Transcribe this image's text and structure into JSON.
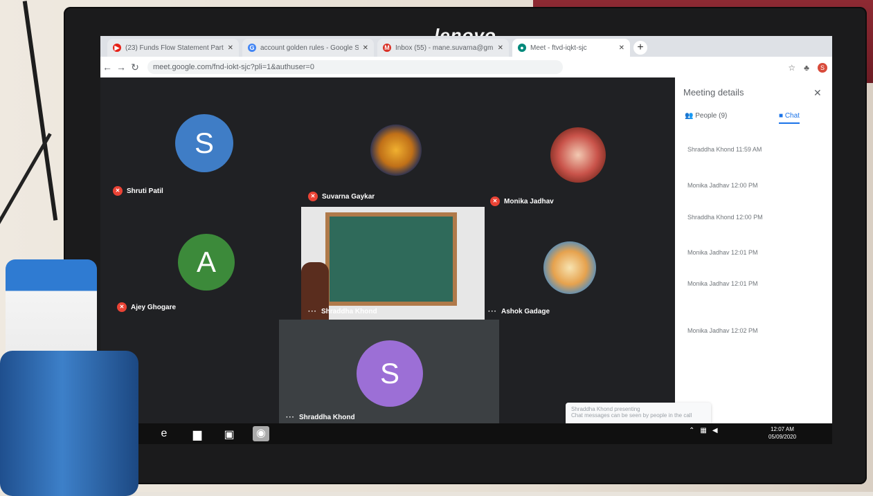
{
  "monitor": {
    "brand": "lenovo"
  },
  "browser": {
    "tabs": [
      {
        "icon": "youtube-icon",
        "icon_color": "#e62117",
        "title": "(23) Funds Flow Statement Part"
      },
      {
        "icon": "google-icon",
        "icon_color": "#4285f4",
        "title": "account golden rules - Google S"
      },
      {
        "icon": "gmail-icon",
        "icon_color": "#d93025",
        "title": "Inbox (55) - mane.suvarna@gm"
      },
      {
        "icon": "meet-icon",
        "icon_color": "#00897b",
        "title": "Meet - ftvd-iqkt-sjc"
      }
    ],
    "new_tab": "+",
    "url": "meet.google.com/fnd-iokt-sjc?pli=1&authuser=0"
  },
  "meet": {
    "participants": [
      {
        "name": "Shruti Patil",
        "initial": "S",
        "color": "#3f7dc6",
        "muted": true
      },
      {
        "name": "Suvarna Gaykar",
        "initial": "",
        "color": "#1a2a5a",
        "muted": true
      },
      {
        "name": "Monika Jadhav",
        "initial": "",
        "color": "#b05030",
        "muted": true
      },
      {
        "name": "Ajey Ghogare",
        "initial": "A",
        "color": "#3c8a3a",
        "muted": true
      },
      {
        "name": "Shraddha Khond",
        "initial": "",
        "color": "#6a7f7a",
        "muted": false
      },
      {
        "name": "Ashok Gadage",
        "initial": "",
        "color": "#c98a4a",
        "muted": false
      },
      {
        "name": "Shraddha Khond",
        "initial": "S",
        "color": "#9c6fd6",
        "muted": false
      }
    ]
  },
  "panel": {
    "title": "Meeting details",
    "tab_people": "People (9)",
    "tab_chat": "Chat",
    "messages": [
      "Shraddha Khond 11:59 AM",
      "Monika Jadhav 12:00 PM",
      "Shraddha Khond 12:00 PM",
      "Monika Jadhav 12:01 PM",
      "Monika Jadhav 12:01 PM",
      "Monika Jadhav 12:02 PM"
    ],
    "notification_title": "Shraddha Khond presenting",
    "notification_body": "Chat messages can be seen by people in the call"
  },
  "taskbar": {
    "time": "12:07 AM",
    "date": "05/09/2020"
  }
}
